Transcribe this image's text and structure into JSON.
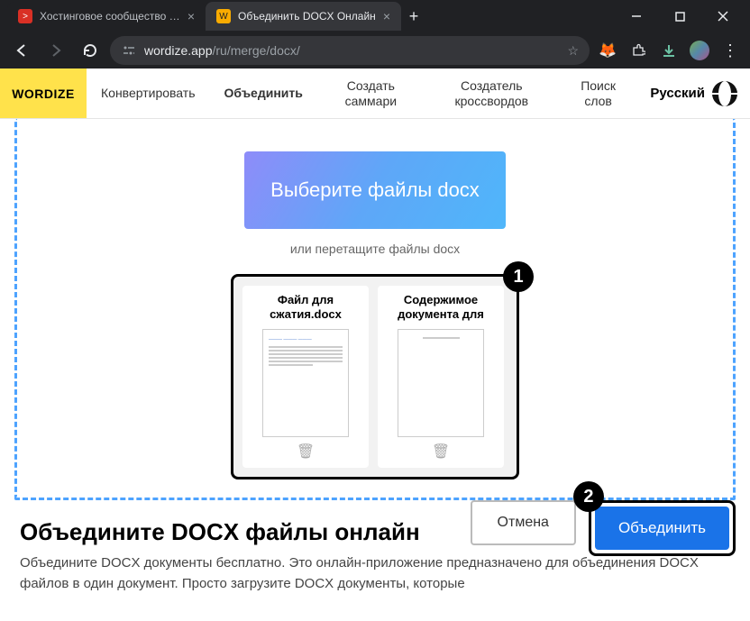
{
  "browser": {
    "tabs": [
      {
        "title": "Хостинговое сообщество «Tim"
      },
      {
        "title": "Объединить DOCX Онлайн"
      }
    ],
    "url_domain": "wordize.app",
    "url_path": "/ru/merge/docx/"
  },
  "site": {
    "logo": "WORDIZE",
    "nav": {
      "convert": "Конвертировать",
      "merge": "Объединить",
      "summary": "Создать саммари",
      "crossword": "Создатель кроссвордов",
      "wordsearch": "Поиск слов"
    },
    "language": "Русский"
  },
  "main": {
    "upload_button": "Выберите файлы docx",
    "drag_hint": "или перетащите файлы docx",
    "files": [
      {
        "name": "Файл для сжатия.docx"
      },
      {
        "name": "Содержимое документа для"
      }
    ],
    "cancel": "Отмена",
    "merge": "Объединить",
    "heading": "Объедините DOCX файлы онлайн",
    "paragraph": "Объедините DOCX документы бесплатно. Это онлайн-приложение предназначено для объединения DOCX файлов в один документ. Просто загрузите DOCX документы, которые",
    "callouts": {
      "one": "1",
      "two": "2"
    }
  }
}
